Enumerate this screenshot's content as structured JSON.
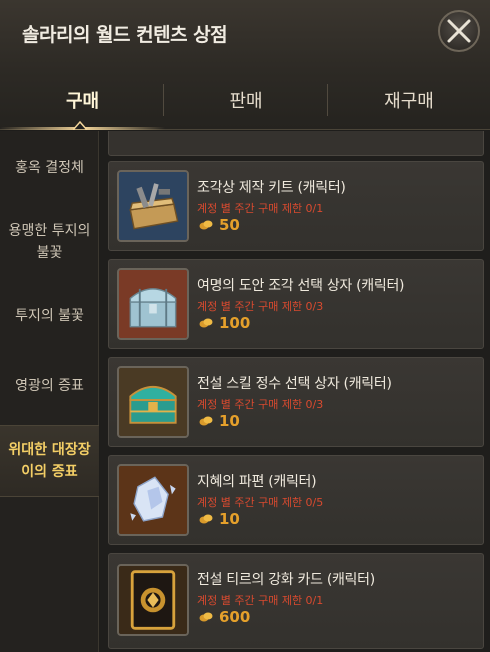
{
  "window": {
    "title": "솔라리의 월드 컨텐츠 상점"
  },
  "tabs": [
    {
      "label": "구매",
      "active": true
    },
    {
      "label": "판매",
      "active": false
    },
    {
      "label": "재구매",
      "active": false
    }
  ],
  "sidebar": {
    "items": [
      {
        "label": "홍옥 결정체",
        "active": false
      },
      {
        "label": "용맹한 투지의 불꽃",
        "active": false
      },
      {
        "label": "투지의 불꽃",
        "active": false
      },
      {
        "label": "영광의 증표",
        "active": false
      },
      {
        "label": "위대한 대장장이의 증표",
        "active": true
      }
    ]
  },
  "products": [
    {
      "name": "조각상 제작 키트 (캐릭터)",
      "limit": "계정 별 주간 구매 제한 0/1",
      "price": "50",
      "icon": "toolbox-icon"
    },
    {
      "name": "여명의 도안 조각 선택 상자 (캐릭터)",
      "limit": "계정 별 주간 구매 제한 0/3",
      "price": "100",
      "icon": "silver-chest-icon"
    },
    {
      "name": "전설 스킬 정수 선택 상자 (캐릭터)",
      "limit": "계정 별 주간 구매 제한 0/3",
      "price": "10",
      "icon": "teal-chest-icon"
    },
    {
      "name": "지혜의 파편 (캐릭터)",
      "limit": "계정 별 주간 구매 제한 0/5",
      "price": "10",
      "icon": "crystal-shard-icon"
    },
    {
      "name": "전설 티르의 강화 카드 (캐릭터)",
      "limit": "계정 별 주간 구매 제한 0/1",
      "price": "600",
      "icon": "enhance-card-icon"
    }
  ],
  "colors": {
    "accent": "#f4cf66",
    "price": "#e5a02b",
    "limit": "#d84a2f"
  }
}
